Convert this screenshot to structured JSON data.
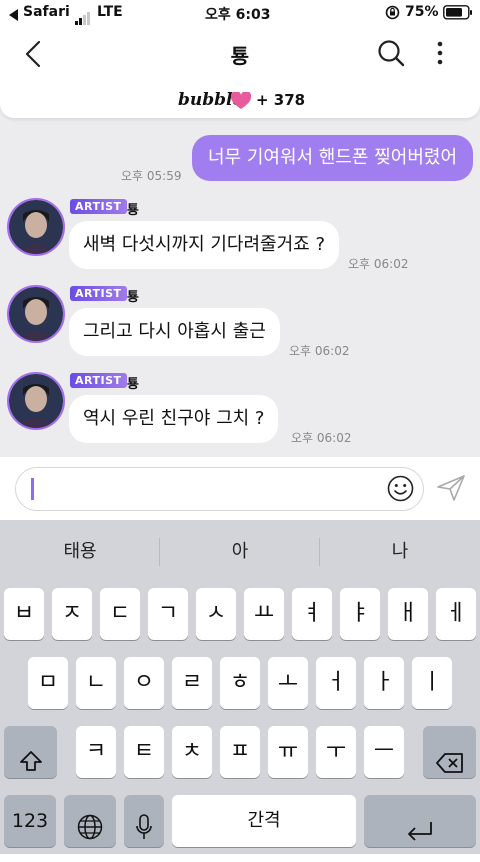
{
  "status_bar": {
    "back_app": "Safari",
    "network": "LTE",
    "time": "오후 6:03",
    "battery": "75%"
  },
  "header": {
    "title": "툥"
  },
  "banner": {
    "brand": "bubble",
    "count": "+ 378"
  },
  "messages": [
    {
      "from": "me",
      "text": "너무 기여워서 핸드폰 찢어버렸어",
      "time": "오후 05:59"
    },
    {
      "from": "artist",
      "badge": "ARTIST",
      "sender": "툥",
      "text": "새벽 다섯시까지 기다려줄거죠 ?",
      "time": "오후 06:02"
    },
    {
      "from": "artist",
      "badge": "ARTIST",
      "sender": "툥",
      "text": "그리고 다시 아홉시 출근",
      "time": "오후 06:02"
    },
    {
      "from": "artist",
      "badge": "ARTIST",
      "sender": "툥",
      "text": "역시 우린 친구야 그치 ?",
      "time": "오후 06:02"
    }
  ],
  "input": {
    "value": ""
  },
  "keyboard": {
    "suggestions": [
      "태용",
      "아",
      "나"
    ],
    "row1": [
      "ㅂ",
      "ㅈ",
      "ㄷ",
      "ㄱ",
      "ㅅ",
      "ㅛ",
      "ㅕ",
      "ㅑ",
      "ㅐ",
      "ㅔ"
    ],
    "row2": [
      "ㅁ",
      "ㄴ",
      "ㅇ",
      "ㄹ",
      "ㅎ",
      "ㅗ",
      "ㅓ",
      "ㅏ",
      "ㅣ"
    ],
    "row3": [
      "ㅋ",
      "ㅌ",
      "ㅊ",
      "ㅍ",
      "ㅠ",
      "ㅜ",
      "ㅡ"
    ],
    "numbers_key": "123",
    "space_key": "간격"
  },
  "colors": {
    "accent": "#a17ef0",
    "heart": "#e85a9b",
    "chat_bg": "#ececef",
    "keyboard_bg": "#d2d4d9"
  },
  "icons": [
    "back-chevron-icon",
    "search-icon",
    "more-vertical-icon",
    "heart-icon",
    "smiley-icon",
    "send-icon",
    "shift-icon",
    "backspace-icon",
    "globe-icon",
    "mic-icon",
    "return-icon"
  ]
}
